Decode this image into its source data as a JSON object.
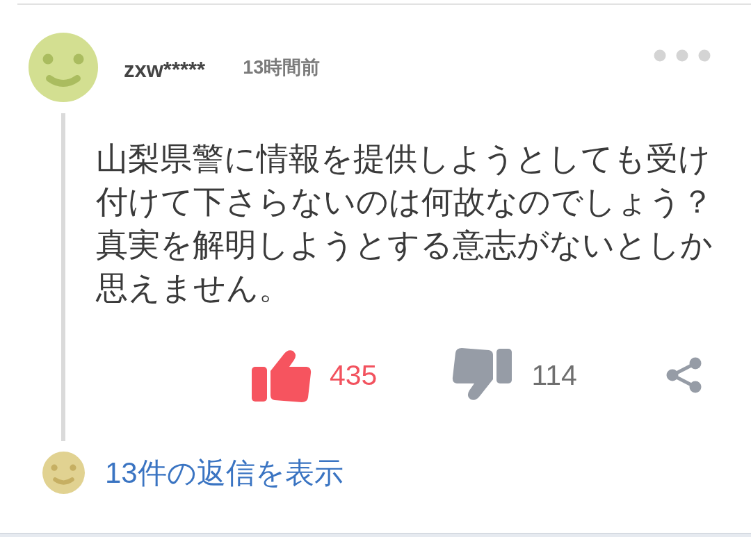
{
  "comment": {
    "author": "zxw*****",
    "posted": "13時間前",
    "body": "山梨県警に情報を提供しようとしても受け付けて下さらないのは何故なのでしょう？真実を解明しようとする意志がないとしか思えません。",
    "reactions": {
      "likes": "435",
      "dislikes": "114"
    }
  },
  "replies": {
    "label": "13件の返信を表示"
  }
}
